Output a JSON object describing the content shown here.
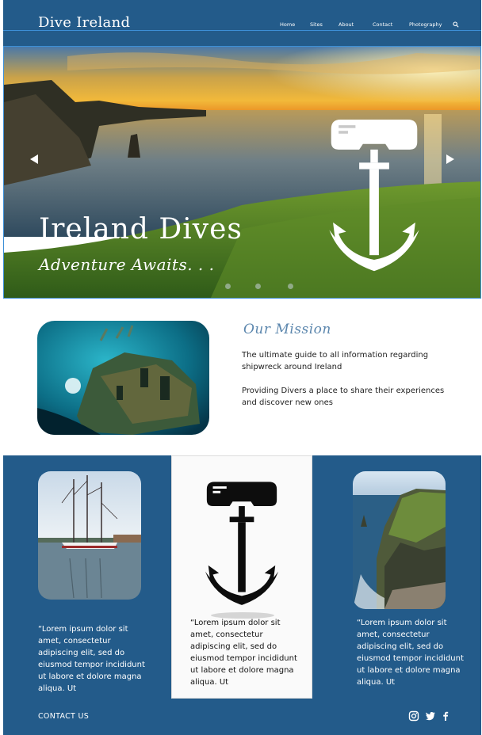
{
  "header": {
    "logo": "Dive Ireland",
    "nav": [
      {
        "label": "Home"
      },
      {
        "label": "Sites"
      },
      {
        "label": "About"
      },
      {
        "label": "Contact"
      },
      {
        "label": "Photography"
      }
    ],
    "search_icon": "search-icon"
  },
  "hero": {
    "title": "Ireland Dives",
    "subtitle": "Adventure Awaits. . .",
    "slide_count": 3
  },
  "mission": {
    "title": "Our Mission",
    "paragraph1": "The ultimate guide to all information regarding shipwreck around Ireland",
    "paragraph2": "Providing Divers a place to share their experiences and discover new ones"
  },
  "cards": [
    {
      "text": "“Lorem ipsum dolor sit amet, consectetur adipiscing elit, sed do eiusmod tempor incididunt ut labore et dolore magna aliqua. Ut"
    },
    {
      "text": "“Lorem ipsum dolor sit amet, consectetur adipiscing elit, sed do eiusmod tempor incididunt ut labore et dolore magna aliqua. Ut"
    },
    {
      "text": "“Lorem ipsum dolor sit amet, consectetur adipiscing elit, sed do eiusmod tempor incididunt ut labore et dolore magna aliqua. Ut"
    }
  ],
  "footer": {
    "contact_label": "CONTACT US",
    "social_icons": [
      "instagram-icon",
      "twitter-icon",
      "facebook-icon"
    ]
  },
  "colors": {
    "brand_blue": "#235b8a",
    "accent_text": "#5b86ad"
  }
}
